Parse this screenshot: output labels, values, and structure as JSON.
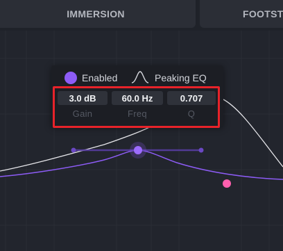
{
  "tabs": [
    {
      "label": "IMMERSION"
    },
    {
      "label": "FOOTST"
    }
  ],
  "band_popup": {
    "enabled_label": "Enabled",
    "filter_type_label": "Peaking EQ",
    "gain": {
      "value": "3.0 dB",
      "label": "Gain"
    },
    "freq": {
      "value": "60.0 Hz",
      "label": "Freq"
    },
    "q": {
      "value": "0.707",
      "label": "Q"
    }
  },
  "colors": {
    "accent": "#8d5cf6",
    "accent_secondary": "#ff5fae",
    "highlight": "#e8232a",
    "overall_curve": "#e6e6ea"
  }
}
